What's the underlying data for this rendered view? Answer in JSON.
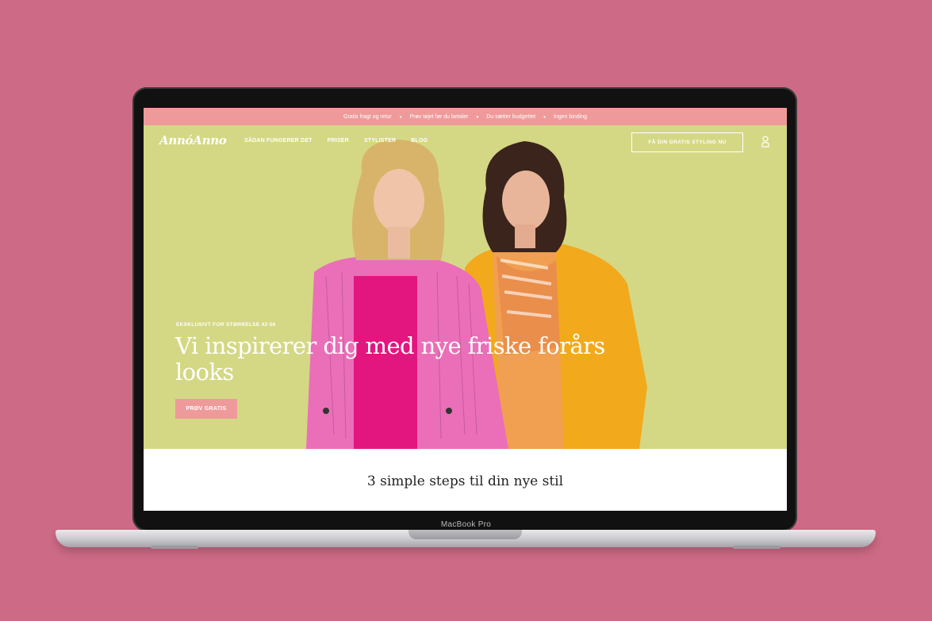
{
  "device": {
    "label": "MacBook Pro"
  },
  "topbar": {
    "items": [
      "Gratis fragt og retur",
      "Prøv tøjet før du betaler",
      "Du sætter budgettet",
      "Ingen binding"
    ]
  },
  "header": {
    "logo": "AnnóAnno",
    "nav": [
      "SÅDAN FUNGERER DET",
      "PRISER",
      "STYLISTER",
      "BLOG"
    ],
    "cta": "FÅ DIN GRATIS STYLING NU",
    "account_icon": "user-icon"
  },
  "hero": {
    "eyebrow": "EKSKLUSIVT FOR STØRRELSE 42-56",
    "headline": "Vi inspirerer dig med nye friske forårs looks",
    "button": "PRØV GRATIS",
    "colors": {
      "background": "#d4d884",
      "accent": "#ef9a9a"
    }
  },
  "steps": {
    "title": "3 simple steps til din nye stil"
  }
}
